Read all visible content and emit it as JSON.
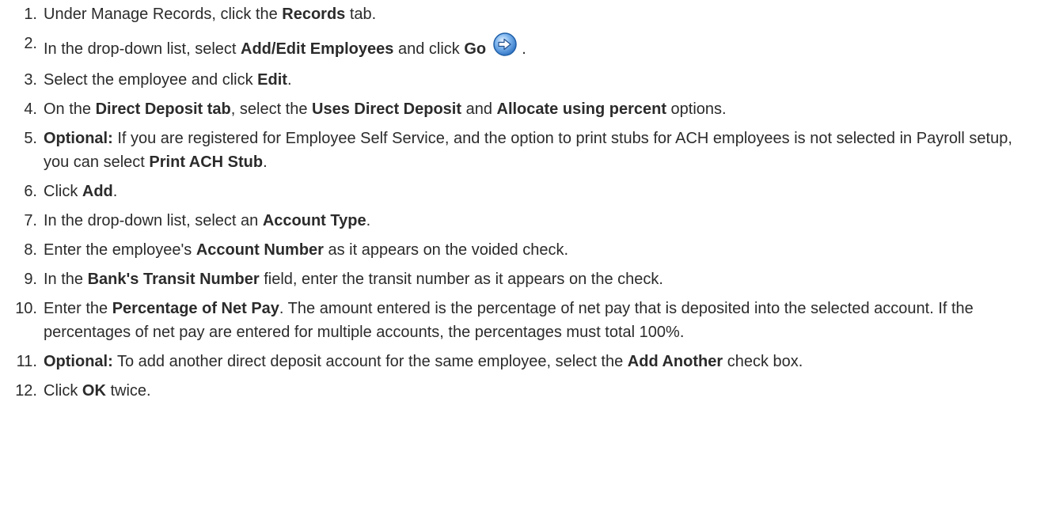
{
  "steps": [
    {
      "num": "1.",
      "parts": [
        {
          "t": "Under Manage Records, click the "
        },
        {
          "t": "Records",
          "b": true
        },
        {
          "t": " tab."
        }
      ]
    },
    {
      "num": "2.",
      "parts": [
        {
          "t": "In the drop-down list, select "
        },
        {
          "t": "Add/Edit Employees",
          "b": true
        },
        {
          "t": " and click "
        },
        {
          "t": "Go",
          "b": true
        },
        {
          "t": " "
        },
        {
          "icon": "go-arrow-icon"
        },
        {
          "t": " ."
        }
      ]
    },
    {
      "num": "3.",
      "parts": [
        {
          "t": "Select the employee and click "
        },
        {
          "t": "Edit",
          "b": true
        },
        {
          "t": "."
        }
      ]
    },
    {
      "num": "4.",
      "parts": [
        {
          "t": "On the "
        },
        {
          "t": "Direct Deposit tab",
          "b": true
        },
        {
          "t": ", select the "
        },
        {
          "t": "Uses Direct Deposit",
          "b": true
        },
        {
          "t": " and "
        },
        {
          "t": "Allocate using percent",
          "b": true
        },
        {
          "t": " options."
        }
      ]
    },
    {
      "num": "5.",
      "parts": [
        {
          "t": "Optional:",
          "b": true
        },
        {
          "t": " If you are registered for Employee Self Service, and the option to print stubs for ACH employees is not selected in Payroll setup, you can select "
        },
        {
          "t": "Print ACH Stub",
          "b": true
        },
        {
          "t": "."
        }
      ]
    },
    {
      "num": "6.",
      "parts": [
        {
          "t": "Click "
        },
        {
          "t": "Add",
          "b": true
        },
        {
          "t": "."
        }
      ]
    },
    {
      "num": "7.",
      "parts": [
        {
          "t": "In the drop-down list, select an "
        },
        {
          "t": "Account Type",
          "b": true
        },
        {
          "t": "."
        }
      ]
    },
    {
      "num": "8.",
      "parts": [
        {
          "t": "Enter the employee's "
        },
        {
          "t": "Account Number",
          "b": true
        },
        {
          "t": " as it appears on the voided check."
        }
      ]
    },
    {
      "num": "9.",
      "parts": [
        {
          "t": "In the "
        },
        {
          "t": "Bank's Transit Number",
          "b": true
        },
        {
          "t": " field, enter the transit number as it appears on the check."
        }
      ]
    },
    {
      "num": "10.",
      "parts": [
        {
          "t": "Enter the "
        },
        {
          "t": "Percentage of Net Pay",
          "b": true
        },
        {
          "t": ". The amount entered is the percentage of net pay that is deposited into the selected account. If the percentages of net pay are entered for multiple accounts, the percentages must total 100%."
        }
      ]
    },
    {
      "num": "11.",
      "parts": [
        {
          "t": "Optional:",
          "b": true
        },
        {
          "t": " To add another direct deposit account for the same employee, select the "
        },
        {
          "t": "Add Another",
          "b": true
        },
        {
          "t": " check box."
        }
      ]
    },
    {
      "num": "12.",
      "parts": [
        {
          "t": "Click "
        },
        {
          "t": "OK",
          "b": true
        },
        {
          "t": " twice."
        }
      ]
    }
  ],
  "colors": {
    "text": "#2b2b2b",
    "icon_fill": "#4a8fd6",
    "icon_border": "#1f5fa8"
  }
}
